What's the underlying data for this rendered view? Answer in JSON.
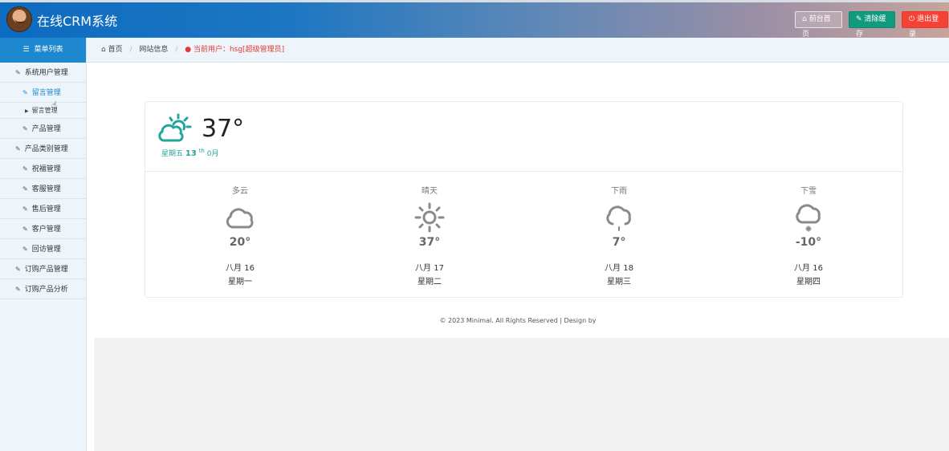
{
  "header": {
    "title": "在线CRM系统",
    "buttons": {
      "front_page": "前台首页",
      "clear_cache": "清除缓存",
      "logout": "退出登录"
    },
    "colors": {
      "clear": "#129a7e",
      "logout": "#f44336"
    }
  },
  "sidebar": {
    "header": "菜单列表",
    "items": [
      {
        "label": "系统用户管理"
      },
      {
        "label": "留言管理"
      },
      {
        "label": "留言管理"
      },
      {
        "label": "产品管理"
      },
      {
        "label": "产品类别管理"
      },
      {
        "label": "祝福管理"
      },
      {
        "label": "客服管理"
      },
      {
        "label": "售后管理"
      },
      {
        "label": "客户管理"
      },
      {
        "label": "回访管理"
      },
      {
        "label": "订购产品管理"
      },
      {
        "label": "订购产品分析"
      }
    ]
  },
  "breadcrumb": {
    "home": "首页",
    "site_info": "网站信息",
    "current_user": "当前用户：hsg[超级管理员]"
  },
  "weather": {
    "current": {
      "icon": "partly-cloudy-day-icon",
      "temp": "37°",
      "weekday": "星期五",
      "day": "13",
      "suffix": "th",
      "month": "0月"
    },
    "forecast": [
      {
        "condition": "多云",
        "icon": "cloud-icon",
        "temp": "20°",
        "date": "八月 16",
        "weekday": "星期一"
      },
      {
        "condition": "晴天",
        "icon": "sun-icon",
        "temp": "37°",
        "date": "八月 17",
        "weekday": "星期二"
      },
      {
        "condition": "下雨",
        "icon": "rain-icon",
        "temp": "7°",
        "date": "八月 18",
        "weekday": "星期三"
      },
      {
        "condition": "下雪",
        "icon": "snow-icon",
        "temp": "-10°",
        "date": "八月 16",
        "weekday": "星期四"
      }
    ]
  },
  "footer": {
    "text": "© 2023 Minimal. All Rights Reserved | Design by"
  }
}
